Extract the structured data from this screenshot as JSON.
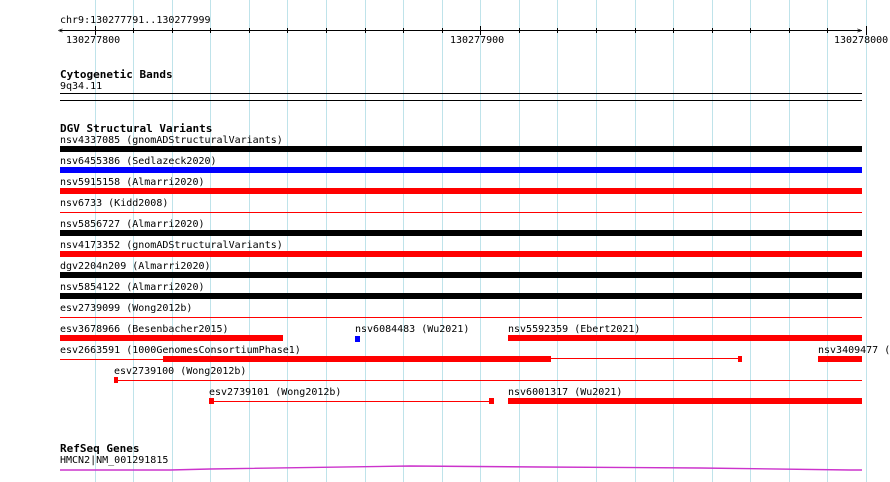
{
  "ruler": {
    "location": "chr9:130277791..130277999",
    "ticks": [
      {
        "label": "130277800",
        "pos": 130277800
      },
      {
        "label": "130277900",
        "pos": 130277900
      },
      {
        "label": "130278000",
        "pos": 130278000
      }
    ],
    "start": 130277791,
    "end": 130277999
  },
  "cytoband": {
    "title": "Cytogenetic Bands",
    "band_label": "9q34.11"
  },
  "dgv": {
    "title": "DGV Structural Variants",
    "colors": {
      "black": "#000000",
      "blue": "#0000ff",
      "red": "#ff0000"
    },
    "features": [
      {
        "label": "nsv4337085 (gnomADStructuralVariants)",
        "color": "black",
        "style": "full"
      },
      {
        "label": "nsv6455386 (Sedlazeck2020)",
        "color": "blue",
        "style": "full"
      },
      {
        "label": "nsv5915158 (Almarri2020)",
        "color": "red",
        "style": "full"
      },
      {
        "label": "nsv6733 (Kidd2008)",
        "color": "red",
        "style": "thin"
      },
      {
        "label": "nsv5856727 (Almarri2020)",
        "color": "black",
        "style": "full"
      },
      {
        "label": "nsv4173352 (gnomADStructuralVariants)",
        "color": "red",
        "style": "full"
      },
      {
        "label": "dgv2204n209 (Almarri2020)",
        "color": "black",
        "style": "full"
      },
      {
        "label": "nsv5854122 (Almarri2020)",
        "color": "black",
        "style": "full"
      },
      {
        "label": "esv2739099 (Wong2012b)",
        "color": "red",
        "style": "thin"
      },
      {
        "label": "esv3678966 (Besenbacher2015)",
        "color": "red",
        "style": "partial"
      },
      {
        "label": "nsv6084483 (Wu2021)",
        "color": "blue",
        "style": "point"
      },
      {
        "label": "nsv5592359 (Ebert2021)",
        "color": "red",
        "style": "partial"
      },
      {
        "label": "esv2663591 (1000GenomesConsortiumPhase1)",
        "color": "red",
        "style": "split"
      },
      {
        "label": "nsv3409477 (",
        "color": "red",
        "style": "partial"
      },
      {
        "label": "esv2739100 (Wong2012b)",
        "color": "red",
        "style": "thin-start"
      },
      {
        "label": "esv2739101 (Wong2012b)",
        "color": "red",
        "style": "linked"
      },
      {
        "label": "nsv6001317 (Wu2021)",
        "color": "red",
        "style": "partial"
      }
    ]
  },
  "refseq": {
    "title": "RefSeq Genes",
    "gene_label": "HMCN2|NM_001291815",
    "color": "#cc33cc"
  }
}
